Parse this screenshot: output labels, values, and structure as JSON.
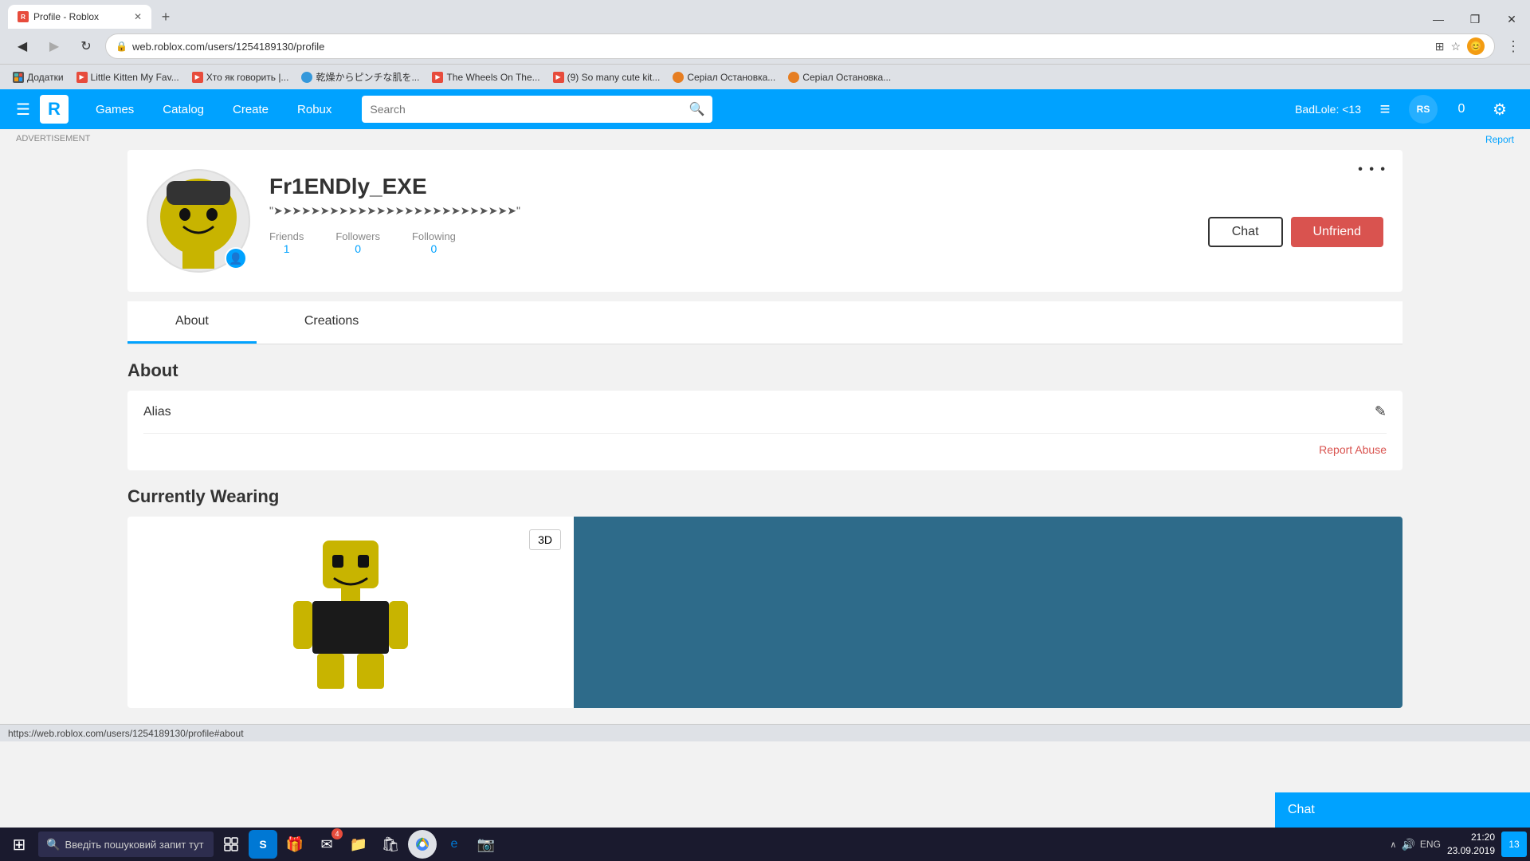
{
  "browser": {
    "tab_title": "Profile - Roblox",
    "tab_favicon": "R",
    "url": "web.roblox.com/users/1254189130/profile",
    "new_tab_label": "+",
    "nav": {
      "back": "←",
      "forward": "→",
      "refresh": "↻",
      "home": ""
    },
    "address_icons": {
      "lock": "🔒",
      "translate": "⊞",
      "star": "☆",
      "avatar": ""
    },
    "window_controls": {
      "minimize": "—",
      "maximize": "❐",
      "close": "✕"
    }
  },
  "bookmarks": [
    {
      "icon": "addons",
      "label": "Додатки",
      "type": "addons"
    },
    {
      "icon": "youtube",
      "label": "Little Kitten My Fav...",
      "type": "yt"
    },
    {
      "icon": "youtube",
      "label": "Хто як говорить |...",
      "type": "yt"
    },
    {
      "icon": "globe",
      "label": "乾燥からピンチな肌を...",
      "type": "globe"
    },
    {
      "icon": "youtube",
      "label": "The Wheels On The...",
      "type": "yt"
    },
    {
      "icon": "youtube",
      "label": "(9) So many cute kit...",
      "type": "yt"
    },
    {
      "icon": "fox",
      "label": "Серіал Остановка...",
      "type": "fox"
    },
    {
      "icon": "fox",
      "label": "Серіал Остановка...",
      "type": "fox"
    }
  ],
  "roblox_nav": {
    "menu_icon": "☰",
    "logo": "R",
    "links": [
      "Games",
      "Catalog",
      "Create",
      "Robux"
    ],
    "search_placeholder": "Search",
    "username": "BadLole: <13",
    "icons": {
      "feed": "≡",
      "robux": "RS",
      "currency_count": "0",
      "settings": "⚙"
    }
  },
  "page": {
    "ad_label": "ADVERTISEMENT",
    "report_label": "Report",
    "profile": {
      "username": "Fr1ENDly_EXE",
      "status": "\"➤➤➤➤➤➤➤➤➤➤➤➤➤➤➤➤➤➤➤➤➤➤➤➤➤➤\"",
      "stats": {
        "friends_label": "Friends",
        "friends_value": "1",
        "followers_label": "Followers",
        "followers_value": "0",
        "following_label": "Following",
        "following_value": "0"
      },
      "actions": {
        "chat_label": "Chat",
        "unfriend_label": "Unfriend"
      },
      "more_icon": "• • •"
    },
    "tabs": [
      {
        "label": "About",
        "active": true
      },
      {
        "label": "Creations",
        "active": false
      }
    ],
    "about": {
      "section_title": "About",
      "alias_label": "Alias",
      "edit_icon": "✎",
      "report_abuse_label": "Report Abuse"
    },
    "wearing": {
      "section_title": "Currently Wearing",
      "btn_3d": "3D"
    }
  },
  "chat_popup": {
    "label": "Chat"
  },
  "taskbar": {
    "start_icon": "⊞",
    "search_placeholder": "Введіть пошуковий запит тут",
    "icons": [
      "📋",
      "S",
      "🎁",
      "✉",
      "📁",
      "🛍",
      "🌐",
      "e",
      "📷"
    ],
    "sys_icons": [
      "🔊",
      "ENG"
    ],
    "time": "21:20",
    "date": "23.09.2019",
    "notif_count": "13"
  },
  "status_bar": {
    "url": "https://web.roblox.com/users/1254189130/profile#about"
  }
}
